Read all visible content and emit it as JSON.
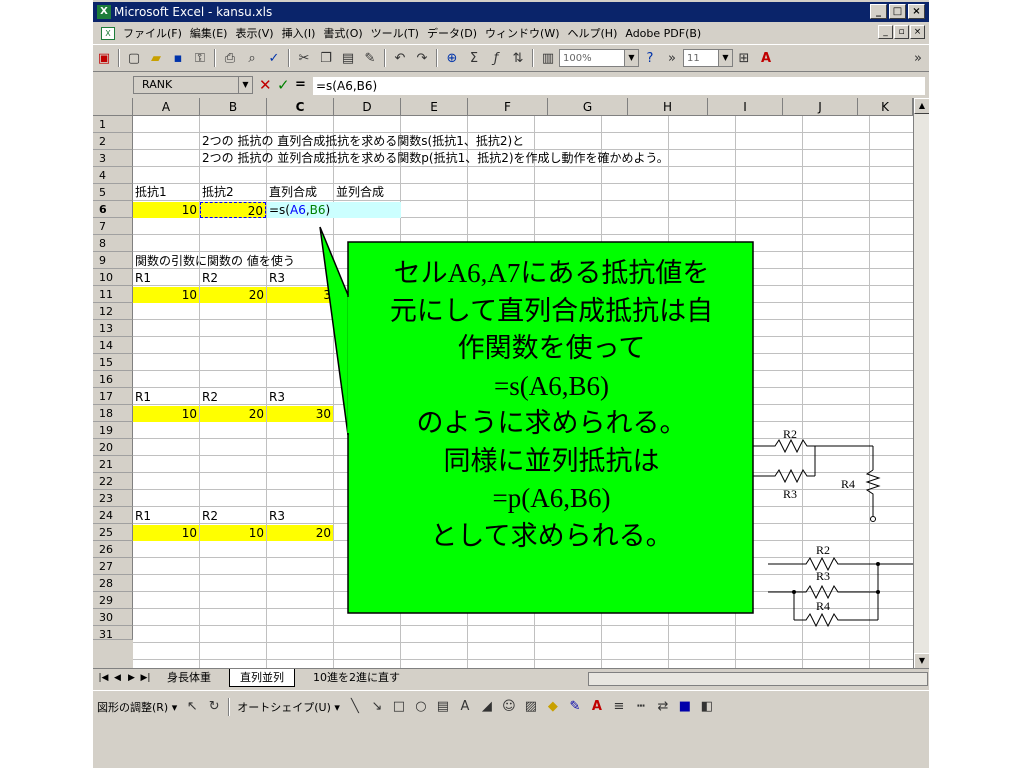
{
  "window": {
    "title": "Microsoft Excel - kansu.xls"
  },
  "menubar": {
    "items": [
      "ファイル(F)",
      "編集(E)",
      "表示(V)",
      "挿入(I)",
      "書式(O)",
      "ツール(T)",
      "データ(D)",
      "ウィンドウ(W)",
      "ヘルプ(H)",
      "Adobe PDF(B)"
    ]
  },
  "toolbar": {
    "zoom": "100%",
    "font_size": "11"
  },
  "formula_bar": {
    "name_box": "RANK",
    "equals": "=",
    "formula": "=s(A6,B6)"
  },
  "columns": [
    "A",
    "B",
    "C",
    "D",
    "E",
    "F",
    "G",
    "H",
    "I",
    "J",
    "K"
  ],
  "rows": [
    "1",
    "2",
    "3",
    "4",
    "5",
    "6",
    "7",
    "8",
    "9",
    "10",
    "11",
    "12",
    "13",
    "14",
    "15",
    "16",
    "17",
    "18",
    "19",
    "20",
    "21",
    "22",
    "23",
    "24",
    "25",
    "26",
    "27",
    "28",
    "29",
    "30",
    "31"
  ],
  "cells": {
    "b2": "2つの 抵抗の 直列合成抵抗を求める関数s(抵抗1、抵抗2)と",
    "b3": "2つの 抵抗の 並列合成抵抗を求める関数p(抵抗1、抵抗2)を作成し動作を確かめよう。",
    "a5": "抵抗1",
    "b5": "抵抗2",
    "c5": "直列合成",
    "d5": "並列合成",
    "a6": "10",
    "b6": "20",
    "c6_pre": "=s(",
    "c6_a": "A6",
    "c6_comma": ",",
    "c6_b": "B6",
    "c6_post": ")",
    "a9": "関数の引数に関数の 値を使う",
    "a10": "R1",
    "b10": "R2",
    "c10": "R3",
    "a11": "10",
    "b11": "20",
    "c11": "3",
    "a16": "R1",
    "b16": "R2",
    "c16": "R3",
    "a17": "10",
    "b17": "20",
    "c17": "30",
    "a23": "R1",
    "b23": "R2",
    "c23": "R3",
    "a24": "10",
    "b24": "10",
    "c24": "20"
  },
  "callout": {
    "lines": [
      "セルA6,A7にある抵抗値を",
      "元にして直列合成抵抗は自",
      "作関数を使って",
      "=s(A6,B6)",
      "のように求められる。",
      "同様に並列抵抗は",
      "=p(A6,B6)",
      "として求められる。"
    ],
    "color": "#00ff00"
  },
  "diagram1": {
    "r2": "R2",
    "r3": "R3",
    "r4": "R4"
  },
  "diagram2": {
    "r2": "R2",
    "r3": "R3",
    "r4": "R4"
  },
  "sheet_tabs": {
    "tabs": [
      "身長体重",
      "直列並列",
      "10進を2進に直す"
    ],
    "active": 1
  },
  "drawbar": {
    "draw": "図形の調整(R) ▾",
    "autoshape": "オートシェイプ(U) ▾"
  }
}
